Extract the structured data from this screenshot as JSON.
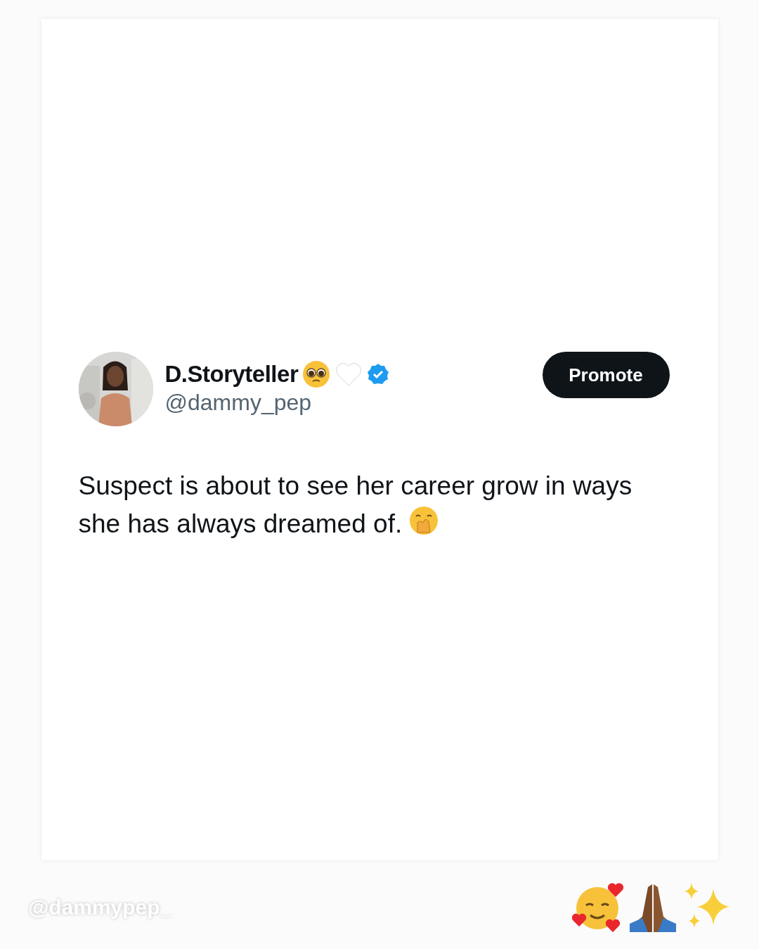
{
  "tweet": {
    "display_name": "D.Storyteller",
    "handle": "@dammy_pep",
    "verified": true,
    "button": "Promote",
    "text": "Suspect is about to see her career grow in ways she has always dreamed of."
  },
  "caption": {
    "handle": "@dammypep_"
  }
}
